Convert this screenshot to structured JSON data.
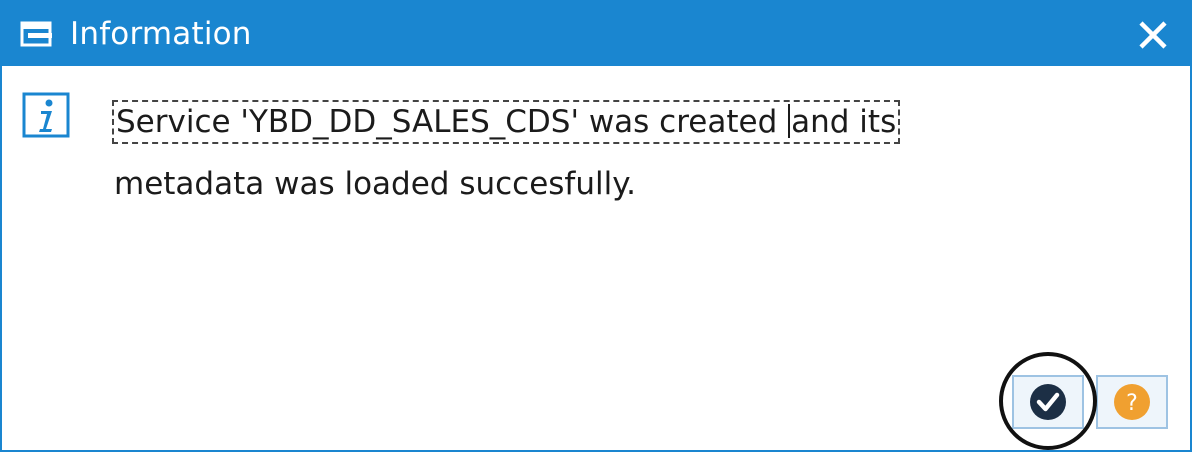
{
  "dialog": {
    "title": "Information",
    "title_icon": "window-icon",
    "close_icon": "close-icon"
  },
  "message": {
    "icon": "info-icon",
    "line1_part1": "Service 'YBD_DD_SALES_CDS' was created ",
    "line1_part2": "and its",
    "line2": "metadata was loaded succesfully."
  },
  "buttons": {
    "ok_icon": "checkmark-icon",
    "help_icon": "help-icon",
    "help_glyph": "?"
  },
  "colors": {
    "titlebar": "#1a86d0",
    "ok_icon": "#1c2f45",
    "help_icon": "#f0a030",
    "highlight_circle": "#111111"
  }
}
